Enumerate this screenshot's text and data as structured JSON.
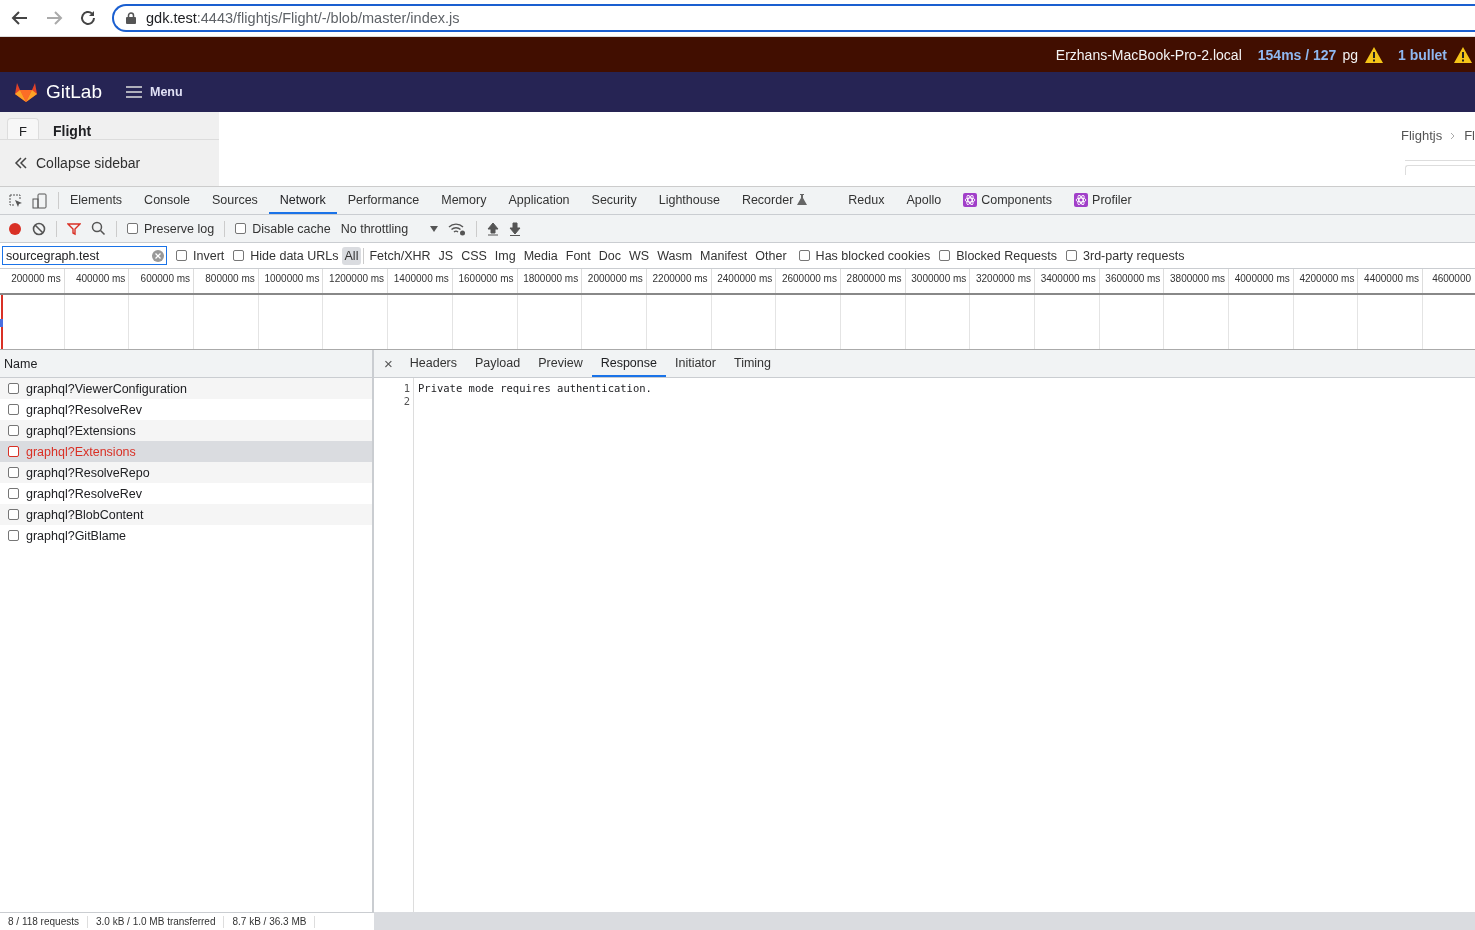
{
  "browser": {
    "url_host": "gdk.test",
    "url_rest": ":4443/flightjs/Flight/-/blob/master/index.js"
  },
  "performance_bar": {
    "host": "Erzhans-MacBook-Pro-2.local",
    "timing": "154ms / 127",
    "timing_unit": "pg",
    "bullets": "1 bullet"
  },
  "gitlab_nav": {
    "brand": "GitLab",
    "menu": "Menu"
  },
  "sidebar": {
    "avatar": "F",
    "project": "Flight",
    "collapse": "Collapse sidebar"
  },
  "breadcrumb": [
    "Flightjs",
    "Fl"
  ],
  "devtools_tabs": [
    {
      "label": "Elements",
      "selected": false,
      "kind": "plain"
    },
    {
      "label": "Console",
      "selected": false,
      "kind": "plain"
    },
    {
      "label": "Sources",
      "selected": false,
      "kind": "plain"
    },
    {
      "label": "Network",
      "selected": true,
      "kind": "plain"
    },
    {
      "label": "Performance",
      "selected": false,
      "kind": "plain"
    },
    {
      "label": "Memory",
      "selected": false,
      "kind": "plain"
    },
    {
      "label": "Application",
      "selected": false,
      "kind": "plain"
    },
    {
      "label": "Security",
      "selected": false,
      "kind": "plain"
    },
    {
      "label": "Lighthouse",
      "selected": false,
      "kind": "plain"
    },
    {
      "label": "Recorder",
      "selected": false,
      "kind": "experiment"
    },
    {
      "label": "Redux",
      "selected": false,
      "kind": "plain"
    },
    {
      "label": "Apollo",
      "selected": false,
      "kind": "plain"
    },
    {
      "label": "Components",
      "selected": false,
      "kind": "extension"
    },
    {
      "label": "Profiler",
      "selected": false,
      "kind": "extension"
    }
  ],
  "toolbar": {
    "recording": true,
    "preserve_log": {
      "label": "Preserve log",
      "checked": false
    },
    "disable_cache": {
      "label": "Disable cache",
      "checked": false
    },
    "throttling": "No throttling"
  },
  "filter": {
    "value": "sourcegraph.test",
    "invert": {
      "label": "Invert",
      "checked": false
    },
    "hide_data_urls": {
      "label": "Hide data URLs",
      "checked": false
    },
    "types": [
      {
        "label": "All",
        "selected": true
      },
      {
        "label": "Fetch/XHR",
        "selected": false
      },
      {
        "label": "JS",
        "selected": false
      },
      {
        "label": "CSS",
        "selected": false
      },
      {
        "label": "Img",
        "selected": false
      },
      {
        "label": "Media",
        "selected": false
      },
      {
        "label": "Font",
        "selected": false
      },
      {
        "label": "Doc",
        "selected": false
      },
      {
        "label": "WS",
        "selected": false
      },
      {
        "label": "Wasm",
        "selected": false
      },
      {
        "label": "Manifest",
        "selected": false
      },
      {
        "label": "Other",
        "selected": false
      }
    ],
    "options": [
      {
        "label": "Has blocked cookies",
        "checked": false
      },
      {
        "label": "Blocked Requests",
        "checked": false
      },
      {
        "label": "3rd-party requests",
        "checked": false
      }
    ]
  },
  "timeline_ticks": [
    "200000 ms",
    "400000 ms",
    "600000 ms",
    "800000 ms",
    "1000000 ms",
    "1200000 ms",
    "1400000 ms",
    "1600000 ms",
    "1800000 ms",
    "2000000 ms",
    "2200000 ms",
    "2400000 ms",
    "2600000 ms",
    "2800000 ms",
    "3000000 ms",
    "3200000 ms",
    "3400000 ms",
    "3600000 ms",
    "3800000 ms",
    "4000000 ms",
    "4200000 ms",
    "4400000 ms",
    "4600000"
  ],
  "requests": {
    "column": "Name",
    "rows": [
      {
        "name": "graphql?ViewerConfiguration",
        "selected": false,
        "error": false
      },
      {
        "name": "graphql?ResolveRev",
        "selected": false,
        "error": false
      },
      {
        "name": "graphql?Extensions",
        "selected": false,
        "error": false
      },
      {
        "name": "graphql?Extensions",
        "selected": true,
        "error": true
      },
      {
        "name": "graphql?ResolveRepo",
        "selected": false,
        "error": false
      },
      {
        "name": "graphql?ResolveRev",
        "selected": false,
        "error": false
      },
      {
        "name": "graphql?BlobContent",
        "selected": false,
        "error": false
      },
      {
        "name": "graphql?GitBlame",
        "selected": false,
        "error": false
      }
    ]
  },
  "detail": {
    "close": "×",
    "tabs": [
      {
        "label": "Headers",
        "selected": false
      },
      {
        "label": "Payload",
        "selected": false
      },
      {
        "label": "Preview",
        "selected": false
      },
      {
        "label": "Response",
        "selected": true
      },
      {
        "label": "Initiator",
        "selected": false
      },
      {
        "label": "Timing",
        "selected": false
      }
    ],
    "lines": [
      {
        "number": "1",
        "text": "Private mode requires authentication."
      },
      {
        "number": "2"
      }
    ]
  },
  "status_bar": [
    "8 / 118 requests",
    "3.0 kB / 1.0 MB transferred",
    "8.7 kB / 36.3 MB"
  ]
}
